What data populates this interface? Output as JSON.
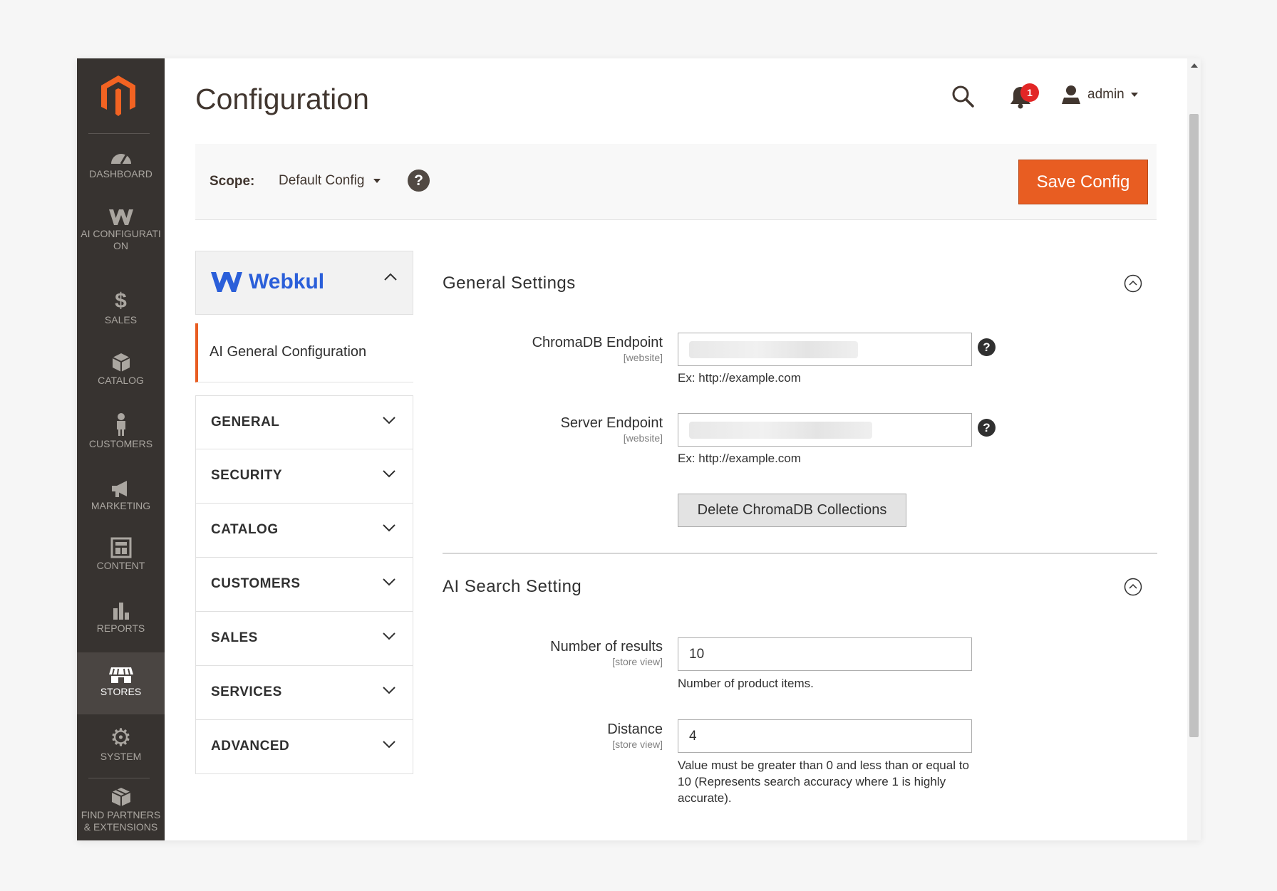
{
  "nav": {
    "items": [
      {
        "label": "DASHBOARD",
        "icon": "gauge-icon"
      },
      {
        "label": "AI CONFIGURATION",
        "icon": "webkul-w-icon"
      },
      {
        "label": "SALES",
        "icon": "dollar-icon"
      },
      {
        "label": "CATALOG",
        "icon": "box-icon"
      },
      {
        "label": "CUSTOMERS",
        "icon": "person-icon"
      },
      {
        "label": "MARKETING",
        "icon": "megaphone-icon"
      },
      {
        "label": "CONTENT",
        "icon": "layout-icon"
      },
      {
        "label": "REPORTS",
        "icon": "bar-chart-icon"
      },
      {
        "label": "STORES",
        "icon": "store-icon",
        "active": true
      },
      {
        "label": "SYSTEM",
        "icon": "gear-icon"
      },
      {
        "label": "FIND PARTNERS & EXTENSIONS",
        "icon": "cubes-icon"
      }
    ]
  },
  "header": {
    "title": "Configuration",
    "notification_count": "1",
    "user": "admin"
  },
  "scope": {
    "label": "Scope:",
    "value": "Default Config",
    "help": "?",
    "save_label": "Save Config"
  },
  "tabs": {
    "webkul_label": "Webkul",
    "active_item": "AI General Configuration",
    "sections": [
      "GENERAL",
      "SECURITY",
      "CATALOG",
      "CUSTOMERS",
      "SALES",
      "SERVICES",
      "ADVANCED"
    ]
  },
  "general_settings": {
    "title": "General Settings",
    "chromadb": {
      "label": "ChromaDB Endpoint",
      "scope": "[website]",
      "note": "Ex: http://example.com"
    },
    "server": {
      "label": "Server Endpoint",
      "scope": "[website]",
      "note": "Ex: http://example.com"
    },
    "delete_label": "Delete ChromaDB Collections"
  },
  "ai_search": {
    "title": "AI Search Setting",
    "results": {
      "label": "Number of results",
      "scope": "[store view]",
      "value": "10",
      "note": "Number of product items."
    },
    "distance": {
      "label": "Distance",
      "scope": "[store view]",
      "value": "4",
      "note": "Value must be greater than 0 and less than or equal to 10 (Represents search accuracy where 1 is highly accurate)."
    }
  },
  "colors": {
    "accent": "#e85d22",
    "nav_bg": "#373330",
    "brand_blue": "#2b5fd9"
  }
}
